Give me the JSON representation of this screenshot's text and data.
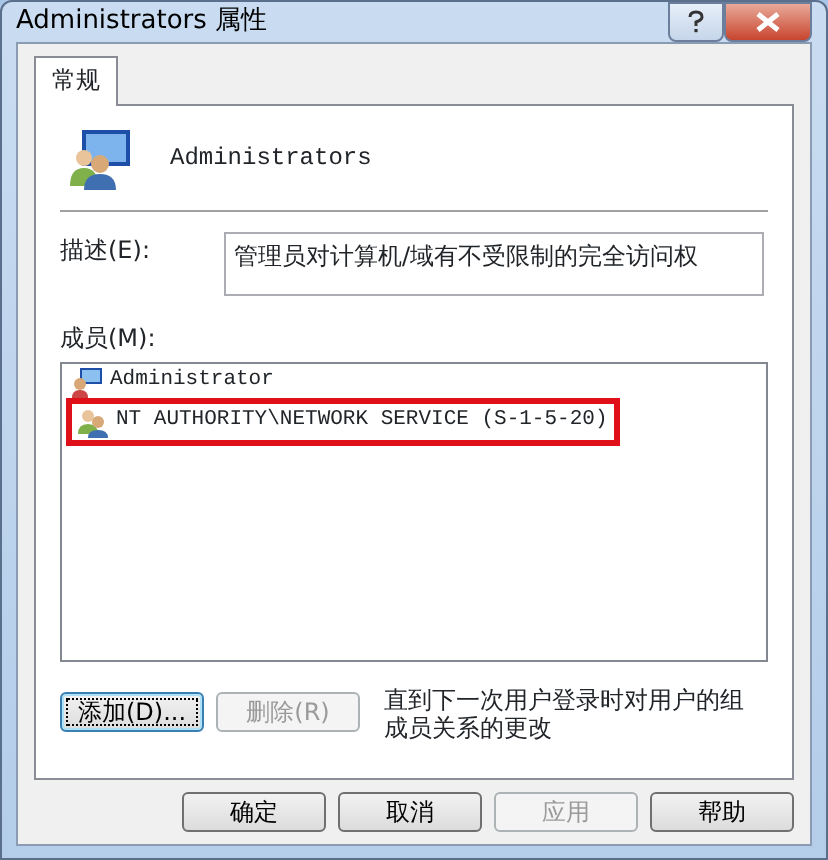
{
  "window": {
    "title": "Administrators 属性"
  },
  "tabs": [
    {
      "label": "常规",
      "selected": true
    }
  ],
  "group_name": "Administrators",
  "description": {
    "label": "描述(E):",
    "value": "管理员对计算机/域有不受限制的完全访问权"
  },
  "members": {
    "label": "成员(M):",
    "items": [
      {
        "name": "Administrator",
        "kind": "user",
        "highlighted": false
      },
      {
        "name": "NT AUTHORITY\\NETWORK SERVICE (S-1-5-20)",
        "kind": "group",
        "highlighted": true
      }
    ]
  },
  "member_buttons": [
    {
      "label": "添加(D)...",
      "disabled": false,
      "focused": true
    },
    {
      "label": "删除(R)",
      "disabled": true,
      "focused": false
    }
  ],
  "note": "直到下一次用户登录时对用户的组成员关系的更改",
  "buttons": [
    {
      "label": "确定",
      "disabled": false
    },
    {
      "label": "取消",
      "disabled": false
    },
    {
      "label": "应用",
      "disabled": true
    },
    {
      "label": "帮助",
      "disabled": false
    }
  ]
}
